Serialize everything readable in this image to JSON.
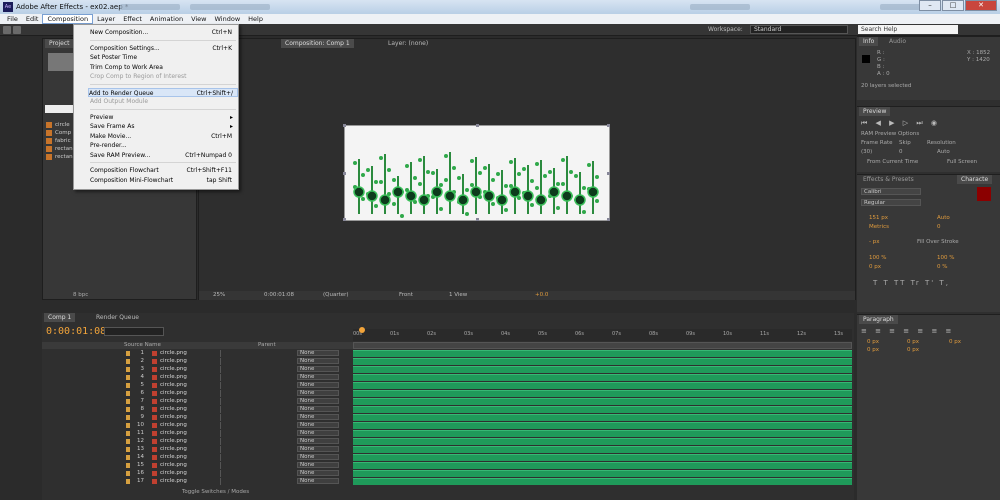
{
  "window": {
    "title": "Adobe After Effects - ex02.aep *",
    "app_icon": "Ae"
  },
  "menubar": [
    "File",
    "Edit",
    "Composition",
    "Layer",
    "Effect",
    "Animation",
    "View",
    "Window",
    "Help"
  ],
  "composition_menu": [
    {
      "label": "New Composition...",
      "shortcut": "Ctrl+N",
      "disabled": false
    },
    {
      "label": "Composition Settings...",
      "shortcut": "Ctrl+K",
      "disabled": false
    },
    {
      "label": "Set Poster Time",
      "shortcut": "",
      "disabled": false
    },
    {
      "label": "Trim Comp to Work Area",
      "shortcut": "",
      "disabled": false
    },
    {
      "label": "Crop Comp to Region of Interest",
      "shortcut": "",
      "disabled": true
    },
    {
      "label": "Add to Render Queue",
      "shortcut": "Ctrl+Shift+/",
      "disabled": false,
      "highlighted": true
    },
    {
      "label": "Add Output Module",
      "shortcut": "",
      "disabled": true
    },
    {
      "label": "Preview",
      "shortcut": "",
      "disabled": false,
      "submenu": true
    },
    {
      "label": "Save Frame As",
      "shortcut": "",
      "disabled": false,
      "submenu": true
    },
    {
      "label": "Make Movie...",
      "shortcut": "Ctrl+M",
      "disabled": false
    },
    {
      "label": "Pre-render...",
      "shortcut": "",
      "disabled": false
    },
    {
      "label": "Save RAM Preview...",
      "shortcut": "Ctrl+Numpad 0",
      "disabled": false
    },
    {
      "label": "Composition Flowchart",
      "shortcut": "Ctrl+Shift+F11",
      "disabled": false
    },
    {
      "label": "Composition Mini-Flowchart",
      "shortcut": "tap Shift",
      "disabled": false
    }
  ],
  "toolbar": {
    "workspace_label": "Workspace:",
    "workspace_value": "Standard",
    "search_help": "Search Help"
  },
  "project_panel": {
    "tab": "Project",
    "items": [
      "circle",
      "Comp",
      "fabric",
      "rectan",
      "rectan"
    ],
    "bpc": "8 bpc"
  },
  "viewer": {
    "tab_prefix": "Composition: Comp 1",
    "layer_tab": "Layer: (none)",
    "zoom": "25%",
    "time": "0:00:01:08",
    "resolution": "(Quarter)",
    "camera": "Front",
    "views": "1 View",
    "offset": "+0.0"
  },
  "timeline": {
    "tab": "Comp 1",
    "render_tab": "Render Queue",
    "timecode": "0:00:01:08",
    "column_source": "Source Name",
    "column_parent": "Parent",
    "toggle": "Toggle Switches / Modes",
    "ruler": [
      "00s",
      "01s",
      "02s",
      "03s",
      "04s",
      "05s",
      "06s",
      "07s",
      "08s",
      "09s",
      "10s",
      "11s",
      "12s",
      "13s"
    ],
    "layers": [
      {
        "n": "1",
        "name": "circle.png",
        "parent": "None"
      },
      {
        "n": "2",
        "name": "circle.png",
        "parent": "None"
      },
      {
        "n": "3",
        "name": "circle.png",
        "parent": "None"
      },
      {
        "n": "4",
        "name": "circle.png",
        "parent": "None"
      },
      {
        "n": "5",
        "name": "circle.png",
        "parent": "None"
      },
      {
        "n": "6",
        "name": "circle.png",
        "parent": "None"
      },
      {
        "n": "7",
        "name": "circle.png",
        "parent": "None"
      },
      {
        "n": "8",
        "name": "circle.png",
        "parent": "None"
      },
      {
        "n": "9",
        "name": "circle.png",
        "parent": "None"
      },
      {
        "n": "10",
        "name": "circle.png",
        "parent": "None"
      },
      {
        "n": "11",
        "name": "circle.png",
        "parent": "None"
      },
      {
        "n": "12",
        "name": "circle.png",
        "parent": "None"
      },
      {
        "n": "13",
        "name": "circle.png",
        "parent": "None"
      },
      {
        "n": "14",
        "name": "circle.png",
        "parent": "None"
      },
      {
        "n": "15",
        "name": "circle.png",
        "parent": "None"
      },
      {
        "n": "16",
        "name": "circle.png",
        "parent": "None"
      },
      {
        "n": "17",
        "name": "circle.png",
        "parent": "None"
      }
    ]
  },
  "info_panel": {
    "tab": "Info",
    "tab2": "Audio",
    "r": "R :",
    "g": "G :",
    "b": "B :",
    "a": "A : 0",
    "x": "X : 1852",
    "y": "Y : 1420",
    "status": "20 layers selected"
  },
  "preview_panel": {
    "tab": "Preview",
    "ram": "RAM Preview Options",
    "frame_rate": "Frame Rate",
    "skip": "Skip",
    "resolution": "Resolution",
    "fps": "(30)",
    "skip_val": "0",
    "res_val": "Auto",
    "from_current": "From Current Time",
    "full_screen": "Full Screen"
  },
  "character_panel": {
    "tab1": "Effects & Presets",
    "tab2": "Characte",
    "font": "Calibri",
    "style": "Regular",
    "size": "151 px",
    "leading": "Auto",
    "kerning": "Metrics",
    "tracking": "0",
    "stroke": "- px",
    "stroke_mode": "Fill Over Stroke",
    "vscale": "100 %",
    "hscale": "100 %",
    "baseline": "0 px",
    "tsume": "0 %",
    "styles": "T T TT Tr T' T,"
  },
  "paragraph_panel": {
    "tab": "Paragraph",
    "indent1": "0 px",
    "indent2": "0 px",
    "indent3": "0 px",
    "space1": "0 px",
    "space2": "0 px"
  },
  "colors": {
    "accent": "#f2a43a",
    "track": "#1f9a5a",
    "swatch": "#8b0000"
  }
}
